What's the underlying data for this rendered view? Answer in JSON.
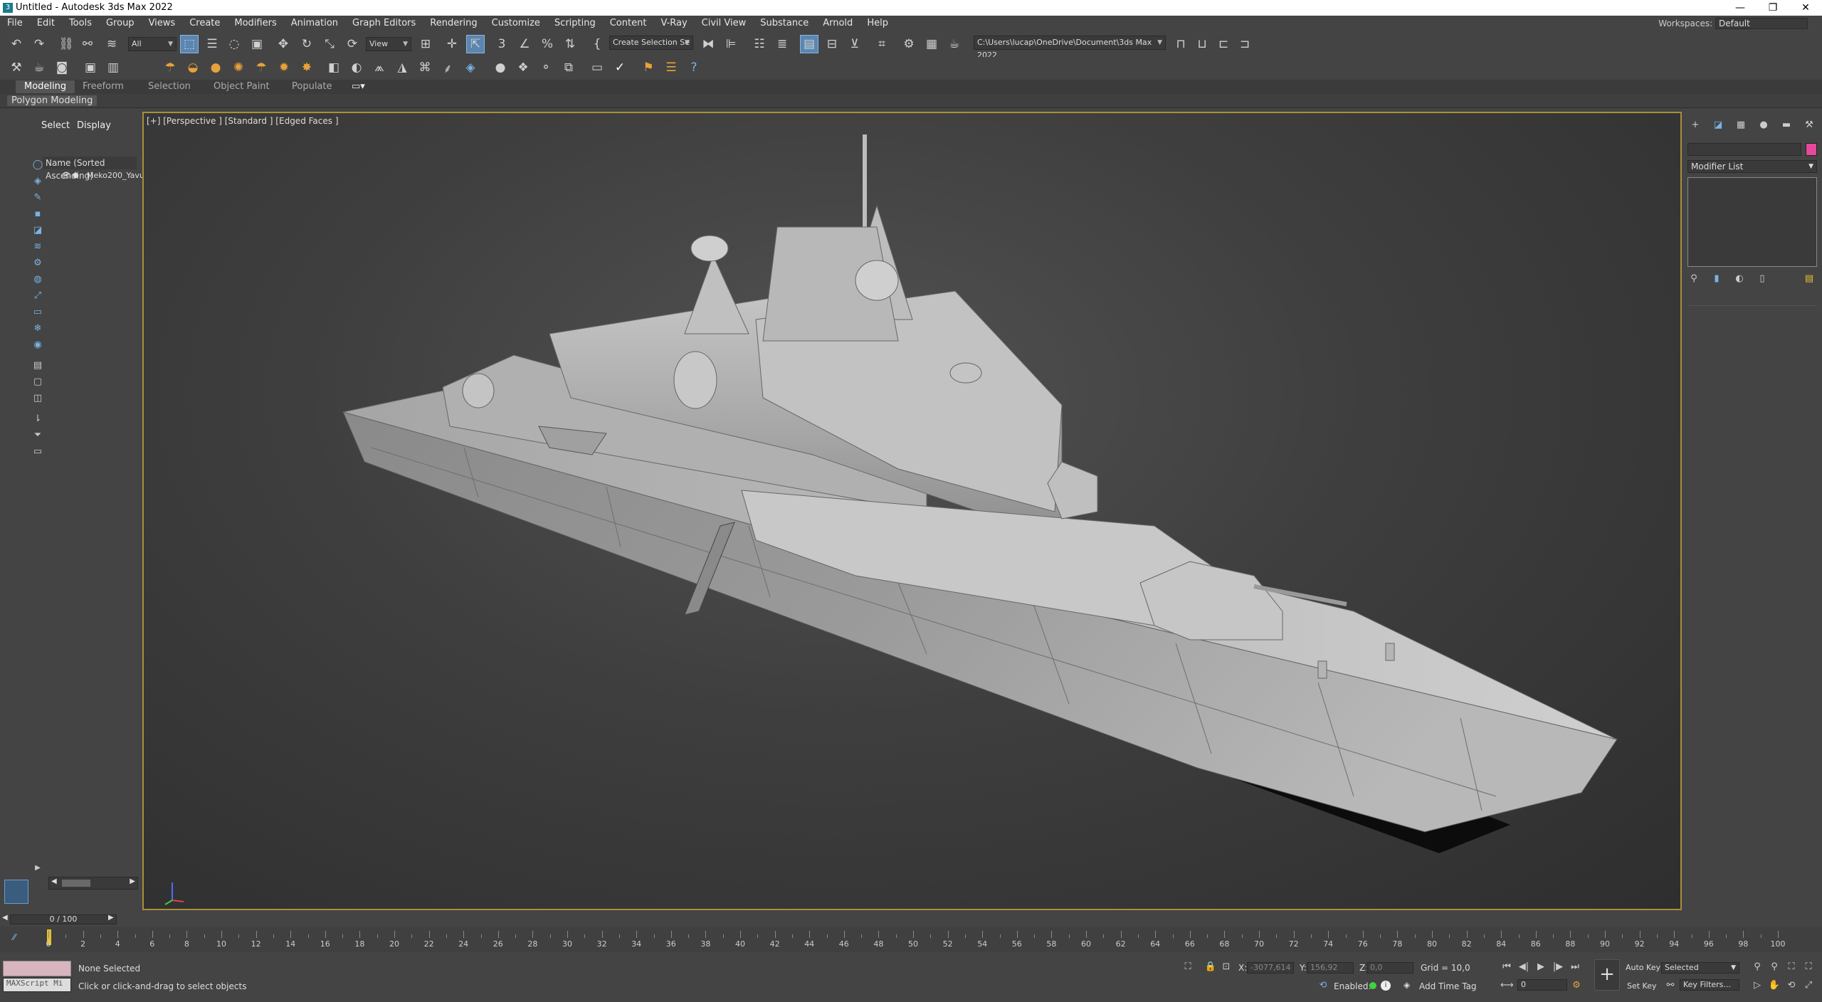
{
  "window": {
    "title": "Untitled - Autodesk 3ds Max 2022",
    "app_icon": "3ds-max-icon",
    "controls": [
      "—",
      "❐",
      "✕"
    ]
  },
  "menu": {
    "items": [
      "File",
      "Edit",
      "Tools",
      "Group",
      "Views",
      "Create",
      "Modifiers",
      "Animation",
      "Graph Editors",
      "Rendering",
      "Customize",
      "Scripting",
      "Content",
      "V-Ray",
      "Civil View",
      "Substance",
      "Arnold",
      "Help"
    ],
    "workspace_label": "Workspaces:",
    "workspace_value": "Default"
  },
  "toolbar": {
    "selection_filter": "All",
    "reference_coord": "View",
    "named_selection": "Create Selection Se",
    "project_path": "C:\\Users\\lucap\\OneDrive\\Document\\3ds Max 2022"
  },
  "ribbon": {
    "tabs": [
      "Modeling",
      "Freeform",
      "Selection",
      "Object Paint",
      "Populate"
    ],
    "active_tab": "Modeling",
    "panel": "Polygon Modeling"
  },
  "scene_explorer": {
    "tabs": [
      "Select",
      "Display"
    ],
    "column_header": "Name (Sorted Ascending)",
    "items": [
      "Meko200_Yavu"
    ]
  },
  "viewport": {
    "label": "[+] [Perspective ] [Standard ] [Edged Faces ]"
  },
  "command_panel": {
    "modifier_list": "Modifier List",
    "object_color": "#e6489b"
  },
  "timeline": {
    "frame_display": "0 / 100",
    "ticks": [
      0,
      2,
      4,
      6,
      8,
      10,
      12,
      14,
      16,
      18,
      20,
      22,
      24,
      26,
      28,
      30,
      32,
      34,
      36,
      38,
      40,
      42,
      44,
      46,
      48,
      50,
      52,
      54,
      56,
      58,
      60,
      62,
      64,
      66,
      68,
      70,
      72,
      74,
      76,
      78,
      80,
      82,
      84,
      86,
      88,
      90,
      92,
      94,
      96,
      98,
      100
    ]
  },
  "status": {
    "maxscript_placeholder": "MAXScript Mi",
    "selection": "None Selected",
    "prompt": "Click or click-and-drag to select objects",
    "x_label": "X:",
    "x_value": "-3077,614",
    "y_label": "Y:",
    "y_value": "156,92",
    "z_label": "Z:",
    "z_value": "0,0",
    "grid": "Grid = 10,0",
    "enabled_label": "Enabled:",
    "add_time_tag": "Add Time Tag",
    "auto_key": "Auto Key",
    "set_key": "Set Key",
    "selected": "Selected",
    "key_filters": "Key Filters...",
    "current_frame": "0"
  }
}
